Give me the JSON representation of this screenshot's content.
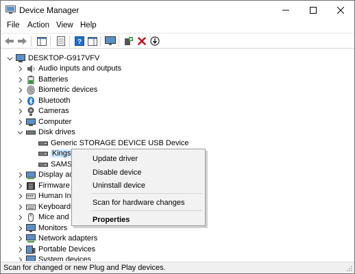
{
  "window": {
    "title": "Device Manager"
  },
  "menu": [
    "File",
    "Action",
    "View",
    "Help"
  ],
  "toolbar": {
    "buttons": [
      "back-icon",
      "forward-icon",
      "show-hide-console-tree-icon",
      "properties-icon",
      "help-icon",
      "action-pane-icon",
      "monitor-icon",
      "add-legacy-hardware-icon",
      "uninstall-x-icon",
      "update-driver-icon"
    ],
    "colors": {
      "uninstall": "#d0021b",
      "add": "#2e9e3a",
      "help": "#1e6fd0"
    }
  },
  "tree": {
    "root": "DESKTOP-G917VFV",
    "items": [
      {
        "label": "Audio inputs and outputs",
        "icon": "speaker-icon",
        "expanded": false
      },
      {
        "label": "Batteries",
        "icon": "battery-icon",
        "expanded": false
      },
      {
        "label": "Biometric devices",
        "icon": "biometric-icon",
        "expanded": false
      },
      {
        "label": "Bluetooth",
        "icon": "bluetooth-icon",
        "expanded": false
      },
      {
        "label": "Cameras",
        "icon": "camera-icon",
        "expanded": false
      },
      {
        "label": "Computer",
        "icon": "computer-icon",
        "expanded": false
      },
      {
        "label": "Disk drives",
        "icon": "disk-drive-icon",
        "expanded": true
      },
      {
        "label": "Generic STORAGE DEVICE USB Device",
        "icon": "drive-icon",
        "child": true
      },
      {
        "label": "Kingsto",
        "icon": "drive-icon",
        "child": true,
        "selected": true
      },
      {
        "label": "SAMSU",
        "icon": "drive-icon",
        "child": true
      },
      {
        "label": "Display ada",
        "icon": "display-adapter-icon",
        "expanded": false
      },
      {
        "label": "Firmware",
        "icon": "firmware-icon",
        "expanded": false
      },
      {
        "label": "Human Int",
        "icon": "hid-icon",
        "expanded": false
      },
      {
        "label": "Keyboards",
        "icon": "keyboard-icon",
        "expanded": false
      },
      {
        "label": "Mice and o",
        "icon": "mouse-icon",
        "expanded": false
      },
      {
        "label": "Monitors",
        "icon": "monitor-icon",
        "expanded": false
      },
      {
        "label": "Network adapters",
        "icon": "network-icon",
        "expanded": false
      },
      {
        "label": "Portable Devices",
        "icon": "portable-device-icon",
        "expanded": false
      },
      {
        "label": "System devices",
        "icon": "system-device-icon",
        "expanded": false
      }
    ]
  },
  "context_menu": {
    "items": [
      "Update driver",
      "Disable device",
      "Uninstall device",
      "Scan for hardware changes",
      "Properties"
    ]
  },
  "status": {
    "text": "Scan for changed or new Plug and Play devices."
  },
  "colors": {
    "selection": "#cce8ff",
    "menu_bg": "#f2f2f2",
    "status_bg": "#f0f0f0"
  }
}
